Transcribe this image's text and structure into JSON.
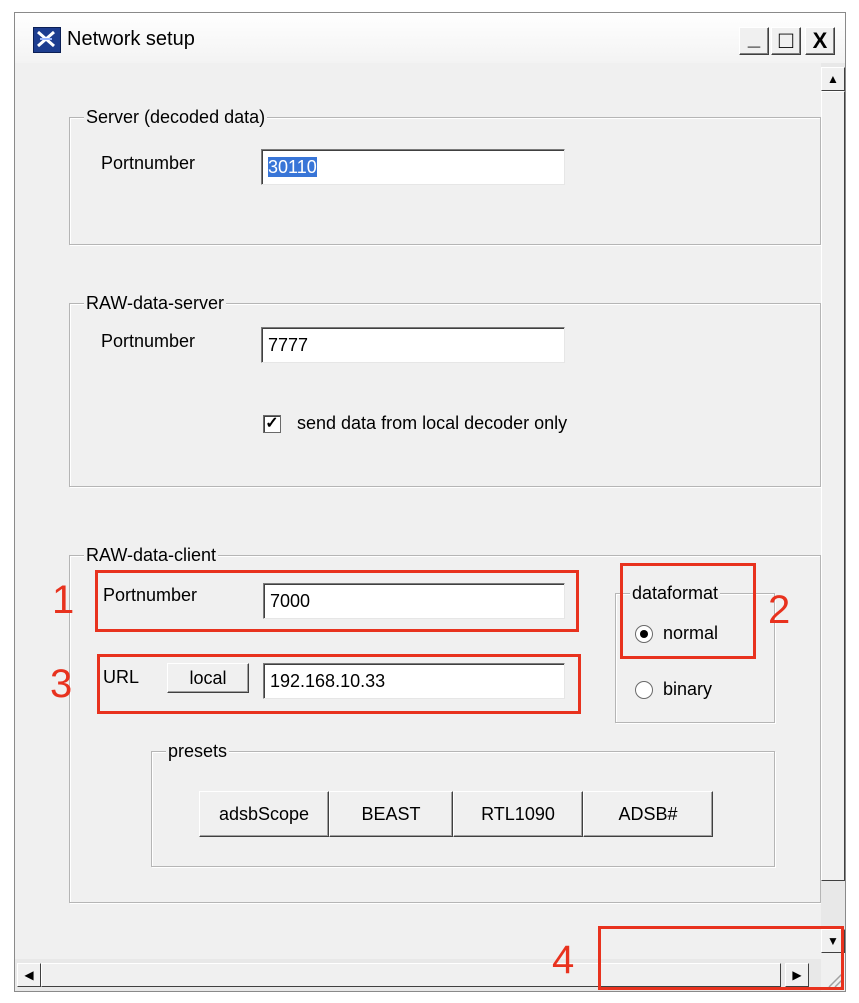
{
  "window": {
    "title": "Network setup"
  },
  "titlebar_buttons": {
    "minimize": "_",
    "maximize": "□",
    "close": "X"
  },
  "server_group": {
    "label": "Server (decoded data)",
    "port_label": "Portnumber",
    "port_value": "30110"
  },
  "raw_server_group": {
    "label": "RAW-data-server",
    "port_label": "Portnumber",
    "port_value": "7777",
    "local_only_label": "send data from local decoder only",
    "local_only_checked": true
  },
  "raw_client_group": {
    "label": "RAW-data-client",
    "port_label": "Portnumber",
    "port_value": "7000",
    "url_label": "URL",
    "local_button": "local",
    "url_value": "192.168.10.33",
    "dataformat": {
      "label": "dataformat",
      "options": [
        "normal",
        "binary"
      ],
      "selected": "normal"
    },
    "presets": {
      "label": "presets",
      "buttons": [
        "adsbScope",
        "BEAST",
        "RTL1090",
        "ADSB#"
      ]
    }
  },
  "annotations": [
    "1",
    "2",
    "3",
    "4"
  ],
  "accent_colors": {
    "annotation": "#e8321e",
    "selection": "#3875d7"
  }
}
